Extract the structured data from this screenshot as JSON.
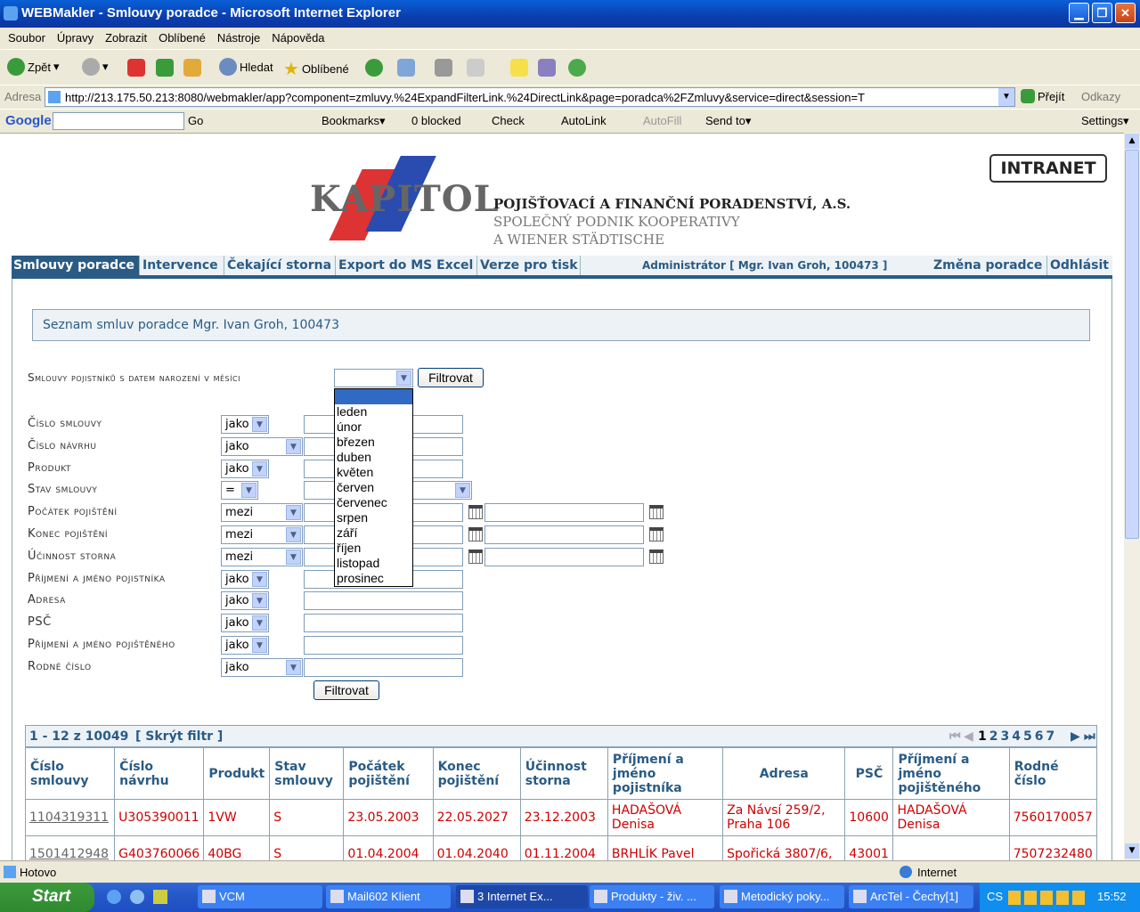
{
  "window": {
    "title": "WEBMakler - Smlouvy poradce - Microsoft Internet Explorer"
  },
  "menu": [
    "Soubor",
    "Úpravy",
    "Zobrazit",
    "Oblíbené",
    "Nástroje",
    "Nápověda"
  ],
  "toolbar": {
    "back": "Zpět",
    "search": "Hledat",
    "favorites": "Oblíbené"
  },
  "address": {
    "label": "Adresa",
    "url": "http://213.175.50.213:8080/webmakler/app?component=zmluvy.%24ExpandFilterLink.%24DirectLink&page=poradca%2FZmluvy&service=direct&session=T",
    "go": "Přejít",
    "links": "Odkazy"
  },
  "google": {
    "logo": "Google",
    "go": "Go",
    "bookmarks": "Bookmarks▾",
    "blocked": "0 blocked",
    "check": "Check",
    "autolink": "AutoLink",
    "autofill": "AutoFill",
    "sendto": "Send to▾",
    "settings": "Settings▾"
  },
  "header": {
    "intranet": "INTRANET",
    "logo": "KAPITOL",
    "line1": "POJIŠŤOVACÍ A FINANČNÍ PORADENSTVÍ, A.S.",
    "line2": "SPOLEČNÝ PODNIK KOOPERATIVY",
    "line3": "A WIENER STÄDTISCHE"
  },
  "nav": {
    "items": [
      "Smlouvy poradce",
      "Intervence",
      "Čekající storna",
      "Export do MS Excel",
      "Verze pro tisk"
    ],
    "user": "Administrátor [ Mgr. Ivan Groh, 100473 ]",
    "change": "Změna poradce",
    "logout": "Odhlásit"
  },
  "list_title": "Seznam smluv poradce Mgr. Ivan Groh, 100473",
  "birth_filter": {
    "label": "Smlouvy pojistníků s datem narození v měsíci",
    "button": "Filtrovat",
    "months": [
      "",
      "leden",
      "únor",
      "březen",
      "duben",
      "květen",
      "červen",
      "červenec",
      "srpen",
      "září",
      "říjen",
      "listopad",
      "prosinec"
    ]
  },
  "filters": [
    {
      "label": "Číslo smlouvy",
      "op": "jako"
    },
    {
      "label": "Číslo návrhu",
      "op": "jako"
    },
    {
      "label": "Produkt",
      "op": "jako"
    },
    {
      "label": "Stav smlouvy",
      "op": "="
    },
    {
      "label": "Počátek pojištění",
      "op": "mezi"
    },
    {
      "label": "Konec pojištění",
      "op": "mezi"
    },
    {
      "label": "Účinnost storna",
      "op": "mezi"
    },
    {
      "label": "Příjmení a jméno pojistníka",
      "op": "jako"
    },
    {
      "label": "Adresa",
      "op": "jako"
    },
    {
      "label": "PSČ",
      "op": "jako"
    },
    {
      "label": "Příjmení a jméno pojištěného",
      "op": "jako"
    },
    {
      "label": "Rodné číslo",
      "op": "jako"
    }
  ],
  "filter_button": "Filtrovat",
  "pager": {
    "info": "1 - 12 z 10049",
    "hide": "[ Skrýt filtr ]",
    "pages": [
      "1",
      "2",
      "3",
      "4",
      "5",
      "6",
      "7"
    ]
  },
  "table": {
    "headers": [
      "Číslo smlouvy",
      "Číslo návrhu",
      "Produkt",
      "Stav smlouvy",
      "Počátek pojištění",
      "Konec pojištění",
      "Účinnost storna",
      "Příjmení a jméno pojistníka",
      "Adresa",
      "PSČ",
      "Příjmení a jméno pojištěného",
      "Rodné číslo"
    ],
    "rows": [
      [
        "1104319311",
        "U305390011",
        "1VW",
        "S",
        "23.05.2003",
        "22.05.2027",
        "23.12.2003",
        "HADAŠOVÁ Denisa",
        "Za Návsí 259/2, Praha 106",
        "10600",
        "HADAŠOVÁ Denisa",
        "7560170057"
      ],
      [
        "1501412948",
        "G403760066",
        "40BG",
        "S",
        "01.04.2004",
        "01.04.2040",
        "01.11.2004",
        "BRHLÍK Pavel",
        "Spořická 3807/6,",
        "43001",
        "",
        "7507232480"
      ]
    ]
  },
  "status": {
    "left": "Hotovo",
    "zone": "Internet"
  },
  "taskbar": {
    "start": "Start",
    "tasks": [
      "VCM",
      "Mail602 Klient",
      "3 Internet Ex...",
      "Produkty - živ. ...",
      "Metodický poky...",
      "ArcTel - Čechy[1]"
    ],
    "lang": "CS",
    "clock": "15:52"
  }
}
